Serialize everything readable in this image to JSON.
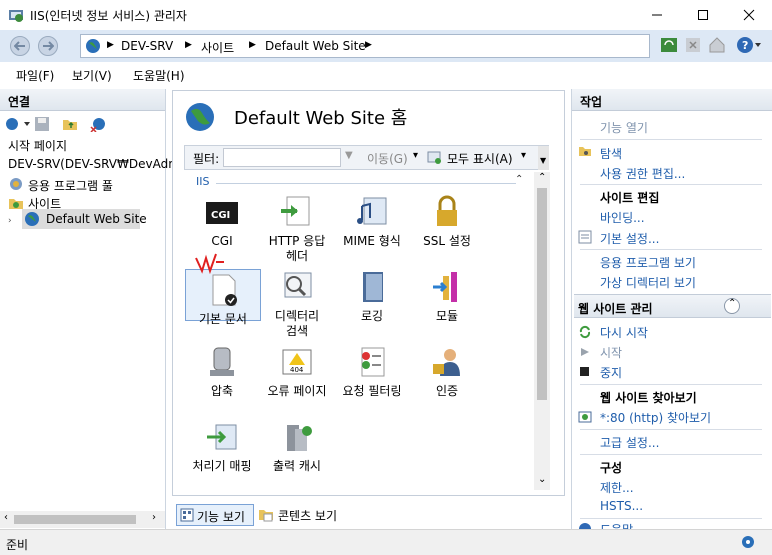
{
  "window": {
    "title": "IIS(인터넷 정보 서비스) 관리자"
  },
  "address": {
    "crumbs": [
      "DEV-SRV",
      "사이트",
      "Default Web Site"
    ]
  },
  "menu": {
    "items": [
      "파일(F)",
      "보기(V)",
      "도움말(H)"
    ]
  },
  "connections": {
    "header": "연결",
    "tree": {
      "start": "시작 페이지",
      "server": "DEV-SRV(DEV-SRV₩DevAdm",
      "apppools": "응용 프로그램 풀",
      "sites": "사이트",
      "site": "Default Web Site"
    }
  },
  "center": {
    "title": "Default Web Site 홈",
    "filter": {
      "label": "필터:",
      "go": "이동(G)",
      "showall": "모두 표시(A)"
    },
    "group": "IIS",
    "features": [
      {
        "label": "CGI",
        "icon": "cgi-icon"
      },
      {
        "label": "HTTP 응답\n헤더",
        "icon": "http-headers-icon"
      },
      {
        "label": "MIME 형식",
        "icon": "mime-icon"
      },
      {
        "label": "SSL 설정",
        "icon": "lock-icon"
      },
      {
        "label": "기본 문서",
        "icon": "default-document-icon"
      },
      {
        "label": "디렉터리\n검색",
        "icon": "directory-browsing-icon"
      },
      {
        "label": "로깅",
        "icon": "logging-icon"
      },
      {
        "label": "모듈",
        "icon": "modules-icon"
      },
      {
        "label": "압축",
        "icon": "compression-icon"
      },
      {
        "label": "오류 페이지",
        "icon": "error-pages-icon"
      },
      {
        "label": "요청 필터링",
        "icon": "request-filtering-icon"
      },
      {
        "label": "인증",
        "icon": "authentication-icon"
      },
      {
        "label": "처리기 매핑",
        "icon": "handler-mappings-icon"
      },
      {
        "label": "출력 캐시",
        "icon": "output-cache-icon"
      }
    ],
    "tabs": {
      "features": "기능 보기",
      "content": "콘텐츠 보기"
    }
  },
  "actions": {
    "header": "작업",
    "open_feature": "기능 열기",
    "explore": "탐색",
    "edit_permissions": "사용 권한 편집...",
    "edit_site": "사이트 편집",
    "bindings": "바인딩...",
    "basic_settings": "기본 설정...",
    "view_apps": "응용 프로그램 보기",
    "view_vdirs": "가상 디렉터리 보기",
    "manage_site": "웹 사이트 관리",
    "restart": "다시 시작",
    "start": "시작",
    "stop": "중지",
    "browse_site": "웹 사이트 찾아보기",
    "browse_80": "*:80 (http) 찾아보기",
    "advanced": "고급 설정...",
    "configure": "구성",
    "limits": "제한...",
    "hsts": "HSTS...",
    "help": "도움말"
  },
  "status": {
    "text": "준비"
  }
}
